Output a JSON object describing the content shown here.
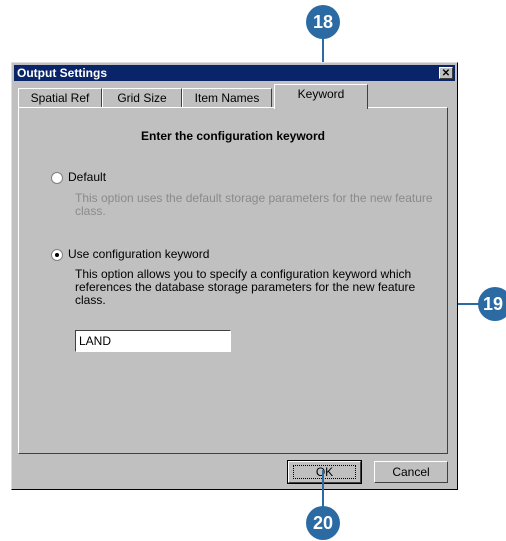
{
  "callouts": {
    "c18": "18",
    "c19": "19",
    "c20": "20"
  },
  "dialog": {
    "title": "Output Settings",
    "close_glyph": "✕",
    "tabs": [
      {
        "label": "Spatial Ref"
      },
      {
        "label": "Grid Size"
      },
      {
        "label": "Item Names"
      },
      {
        "label": "Keyword"
      }
    ],
    "heading": "Enter the configuration keyword",
    "option_default": {
      "label": "Default",
      "description": "This option uses the default storage parameters for the new feature class."
    },
    "option_keyword": {
      "label": "Use configuration keyword",
      "description": "This option allows you to specify a configuration keyword which references the database storage parameters for the new feature class."
    },
    "keyword_value": "LAND",
    "ok_label": "OK",
    "cancel_label": "Cancel"
  },
  "colors": {
    "callout": "#2b6aa3",
    "titlebar": "#0a246a",
    "dialog": "#c0c0c0"
  }
}
